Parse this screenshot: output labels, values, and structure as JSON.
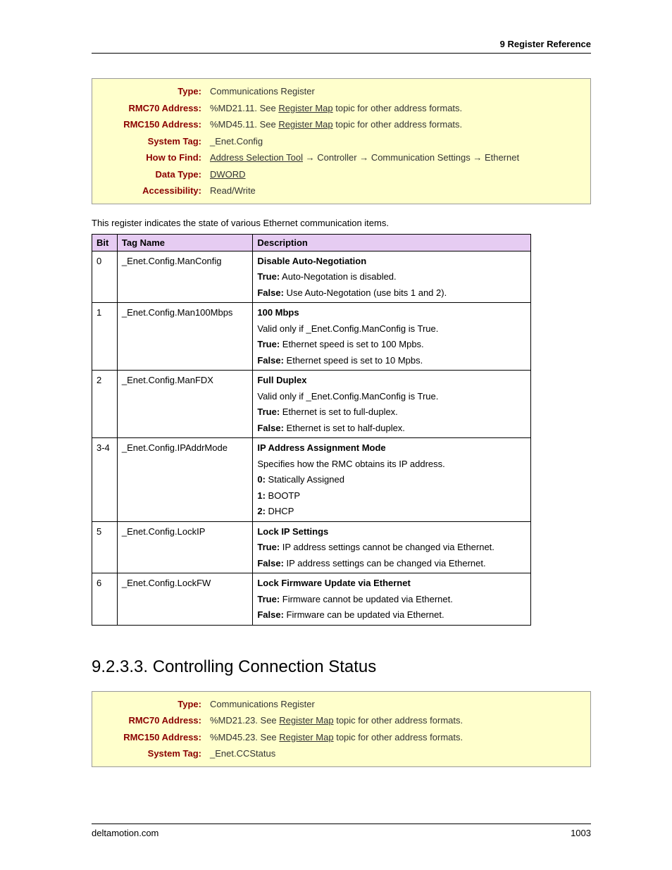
{
  "header": {
    "chapter": "9  Register Reference"
  },
  "box1": {
    "type_label": "Type:",
    "type_value": "Communications Register",
    "rmc70_label": "RMC70 Address:",
    "rmc70_prefix": "%MD21.11. See ",
    "rmc70_link": "Register Map",
    "rmc70_suffix": " topic for other address formats.",
    "rmc150_label": "RMC150 Address:",
    "rmc150_prefix": "%MD45.11. See ",
    "rmc150_link": "Register Map",
    "rmc150_suffix": " topic for other address formats.",
    "systag_label": "System Tag:",
    "systag_value": "_Enet.Config",
    "howto_label": "How to Find:",
    "howto_link": "Address Selection Tool",
    "howto_suffix": " → Controller → Communication Settings → Ethernet",
    "datatype_label": "Data Type:",
    "datatype_link": "DWORD",
    "access_label": "Accessibility:",
    "access_value": "Read/Write"
  },
  "intro_text": "This register indicates the state of various Ethernet communication items.",
  "table": {
    "h_bit": "Bit",
    "h_tag": "Tag Name",
    "h_desc": "Description",
    "rows": [
      {
        "bit": "0",
        "tag": "_Enet.Config.ManConfig",
        "title": "Disable Auto-Negotiation",
        "line1_b": "True:",
        "line1_t": " Auto-Negotation is disabled.",
        "line2_b": "False:",
        "line2_t": " Use Auto-Negotation (use bits 1 and 2)."
      },
      {
        "bit": "1",
        "tag": "_Enet.Config.Man100Mbps",
        "title": "100 Mbps",
        "pre": "Valid only if _Enet.Config.ManConfig is True.",
        "line1_b": "True:",
        "line1_t": " Ethernet speed is set to 100 Mpbs.",
        "line2_b": "False:",
        "line2_t": " Ethernet speed is set to 10 Mpbs."
      },
      {
        "bit": "2",
        "tag": "_Enet.Config.ManFDX",
        "title": "Full Duplex",
        "pre": "Valid only if _Enet.Config.ManConfig is True.",
        "line1_b": "True:",
        "line1_t": " Ethernet is set to full-duplex.",
        "line2_b": "False:",
        "line2_t": " Ethernet is set to half-duplex."
      },
      {
        "bit": "3-4",
        "tag": "_Enet.Config.IPAddrMode",
        "title": "IP Address Assignment Mode",
        "pre": "Specifies how the RMC obtains its IP address.",
        "opt0_b": "0:",
        "opt0_t": " Statically Assigned",
        "opt1_b": "1:",
        "opt1_t": " BOOTP",
        "opt2_b": "2:",
        "opt2_t": " DHCP"
      },
      {
        "bit": "5",
        "tag": "_Enet.Config.LockIP",
        "title": "Lock IP Settings",
        "line1_b": "True:",
        "line1_t": " IP address settings cannot be changed via Ethernet.",
        "line2_b": "False:",
        "line2_t": " IP address settings can be changed via Ethernet."
      },
      {
        "bit": "6",
        "tag": "_Enet.Config.LockFW",
        "title": "Lock Firmware Update via Ethernet",
        "line1_b": "True:",
        "line1_t": " Firmware cannot be updated via Ethernet.",
        "line2_b": "False:",
        "line2_t": " Firmware can be updated via Ethernet."
      }
    ]
  },
  "section_heading": "9.2.3.3. Controlling Connection Status",
  "box2": {
    "type_label": "Type:",
    "type_value": "Communications Register",
    "rmc70_label": "RMC70 Address:",
    "rmc70_prefix": "%MD21.23. See ",
    "rmc70_link": "Register Map",
    "rmc70_suffix": " topic for other address formats.",
    "rmc150_label": "RMC150 Address:",
    "rmc150_prefix": "%MD45.23. See ",
    "rmc150_link": "Register Map",
    "rmc150_suffix": " topic for other address formats.",
    "systag_label": "System Tag:",
    "systag_value": "_Enet.CCStatus"
  },
  "footer": {
    "site": "deltamotion.com",
    "page": "1003"
  }
}
